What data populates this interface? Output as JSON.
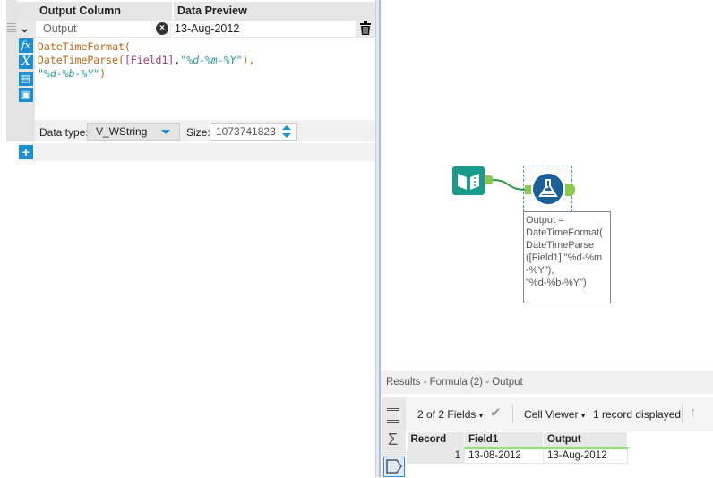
{
  "formula_panel": {
    "header": {
      "output_column": "Output Column",
      "data_preview": "Data Preview"
    },
    "row": {
      "output_name": "Output",
      "preview": "13-Aug-2012"
    },
    "expression": {
      "line1_fn": "DateTimeFormat(",
      "line2_fn": "DateTimeParse(",
      "line2_field": "[Field1]",
      "line2_comma": ",",
      "line2_str": "\"%d-%m-%Y\"",
      "line2_end": "),",
      "line3_str": "\"%d-%b-%Y\"",
      "line3_end": ")"
    },
    "data_type_label": "Data type:",
    "data_type_value": "V_WString",
    "size_label": "Size:",
    "size_value": "1073741823"
  },
  "canvas": {
    "annotation": "Output =\nDateTimeFormat(\nDateTimeParse\n([Field1],\"%d-%m\n-%Y\"),\n\"%d-%b-%Y\")"
  },
  "results": {
    "title": "Results - Formula (2) - Output",
    "fields_label": "2 of 2 Fields",
    "cell_viewer_label": "Cell Viewer",
    "records_label": "1 record displayed",
    "columns": [
      "Record",
      "Field1",
      "Output"
    ],
    "rows": [
      [
        "1",
        "13-08-2012",
        "13-Aug-2012"
      ]
    ]
  },
  "colors": {
    "accent": "#1b8fd0",
    "tool_teal": "#1a9a8a",
    "formula_blue": "#1b5f98",
    "connector_green": "#8cc84b"
  }
}
